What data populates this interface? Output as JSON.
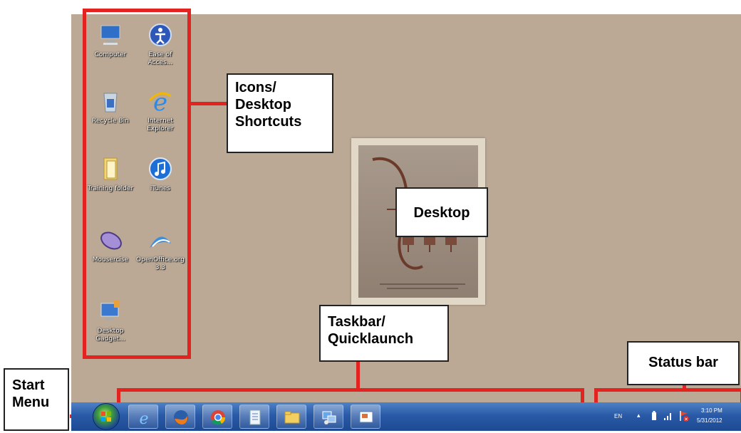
{
  "callouts": {
    "icons": "Icons/\nDesktop\nShortcuts",
    "desktop": "Desktop",
    "taskbar": "Taskbar/\nQuicklaunch",
    "status_bar": "Status bar",
    "start_menu": "Start\nMenu"
  },
  "desktop_icons": [
    {
      "label": "Computer",
      "icon": "computer-icon"
    },
    {
      "label": "Ease of Acces...",
      "icon": "ease-of-access-icon"
    },
    {
      "label": "Recycle Bin",
      "icon": "recycle-bin-icon"
    },
    {
      "label": "Internet Explorer",
      "icon": "internet-explorer-icon"
    },
    {
      "label": "Training folder",
      "icon": "folder-icon"
    },
    {
      "label": "iTunes",
      "icon": "itunes-icon"
    },
    {
      "label": "Mousercise",
      "icon": "mouse-icon"
    },
    {
      "label": "OpenOffice.org 3.3",
      "icon": "openoffice-icon"
    },
    {
      "label": "Desktop Gadget...",
      "icon": "desktop-gadgets-icon"
    }
  ],
  "taskbar_items": [
    {
      "icon": "internet-explorer-icon"
    },
    {
      "icon": "firefox-icon"
    },
    {
      "icon": "chrome-icon"
    },
    {
      "icon": "document-icon"
    },
    {
      "icon": "file-explorer-icon"
    },
    {
      "icon": "network-icon"
    },
    {
      "icon": "presentation-icon"
    }
  ],
  "tray": {
    "language": "EN",
    "time": "3:10 PM",
    "date": "5/31/2012"
  },
  "colors": {
    "highlight": "#e3231f",
    "desktop_bg": "#bba995",
    "taskbar": "#2a5aa7"
  }
}
